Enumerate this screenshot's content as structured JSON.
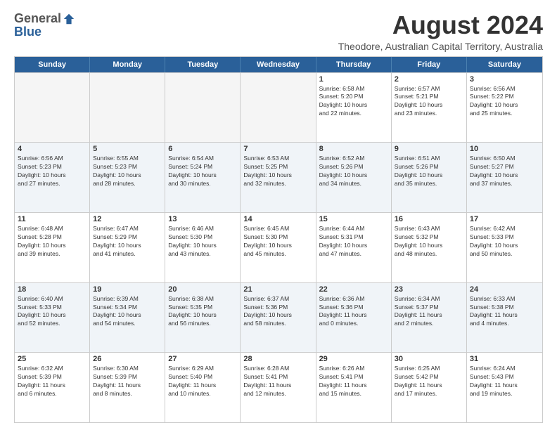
{
  "logo": {
    "general": "General",
    "blue": "Blue"
  },
  "header": {
    "month": "August 2024",
    "location": "Theodore, Australian Capital Territory, Australia"
  },
  "weekdays": [
    "Sunday",
    "Monday",
    "Tuesday",
    "Wednesday",
    "Thursday",
    "Friday",
    "Saturday"
  ],
  "rows": [
    [
      {
        "day": "",
        "text": "",
        "empty": true
      },
      {
        "day": "",
        "text": "",
        "empty": true
      },
      {
        "day": "",
        "text": "",
        "empty": true
      },
      {
        "day": "",
        "text": "",
        "empty": true
      },
      {
        "day": "1",
        "text": "Sunrise: 6:58 AM\nSunset: 5:20 PM\nDaylight: 10 hours\nand 22 minutes."
      },
      {
        "day": "2",
        "text": "Sunrise: 6:57 AM\nSunset: 5:21 PM\nDaylight: 10 hours\nand 23 minutes."
      },
      {
        "day": "3",
        "text": "Sunrise: 6:56 AM\nSunset: 5:22 PM\nDaylight: 10 hours\nand 25 minutes."
      }
    ],
    [
      {
        "day": "4",
        "text": "Sunrise: 6:56 AM\nSunset: 5:23 PM\nDaylight: 10 hours\nand 27 minutes."
      },
      {
        "day": "5",
        "text": "Sunrise: 6:55 AM\nSunset: 5:23 PM\nDaylight: 10 hours\nand 28 minutes."
      },
      {
        "day": "6",
        "text": "Sunrise: 6:54 AM\nSunset: 5:24 PM\nDaylight: 10 hours\nand 30 minutes."
      },
      {
        "day": "7",
        "text": "Sunrise: 6:53 AM\nSunset: 5:25 PM\nDaylight: 10 hours\nand 32 minutes."
      },
      {
        "day": "8",
        "text": "Sunrise: 6:52 AM\nSunset: 5:26 PM\nDaylight: 10 hours\nand 34 minutes."
      },
      {
        "day": "9",
        "text": "Sunrise: 6:51 AM\nSunset: 5:26 PM\nDaylight: 10 hours\nand 35 minutes."
      },
      {
        "day": "10",
        "text": "Sunrise: 6:50 AM\nSunset: 5:27 PM\nDaylight: 10 hours\nand 37 minutes."
      }
    ],
    [
      {
        "day": "11",
        "text": "Sunrise: 6:48 AM\nSunset: 5:28 PM\nDaylight: 10 hours\nand 39 minutes."
      },
      {
        "day": "12",
        "text": "Sunrise: 6:47 AM\nSunset: 5:29 PM\nDaylight: 10 hours\nand 41 minutes."
      },
      {
        "day": "13",
        "text": "Sunrise: 6:46 AM\nSunset: 5:30 PM\nDaylight: 10 hours\nand 43 minutes."
      },
      {
        "day": "14",
        "text": "Sunrise: 6:45 AM\nSunset: 5:30 PM\nDaylight: 10 hours\nand 45 minutes."
      },
      {
        "day": "15",
        "text": "Sunrise: 6:44 AM\nSunset: 5:31 PM\nDaylight: 10 hours\nand 47 minutes."
      },
      {
        "day": "16",
        "text": "Sunrise: 6:43 AM\nSunset: 5:32 PM\nDaylight: 10 hours\nand 48 minutes."
      },
      {
        "day": "17",
        "text": "Sunrise: 6:42 AM\nSunset: 5:33 PM\nDaylight: 10 hours\nand 50 minutes."
      }
    ],
    [
      {
        "day": "18",
        "text": "Sunrise: 6:40 AM\nSunset: 5:33 PM\nDaylight: 10 hours\nand 52 minutes."
      },
      {
        "day": "19",
        "text": "Sunrise: 6:39 AM\nSunset: 5:34 PM\nDaylight: 10 hours\nand 54 minutes."
      },
      {
        "day": "20",
        "text": "Sunrise: 6:38 AM\nSunset: 5:35 PM\nDaylight: 10 hours\nand 56 minutes."
      },
      {
        "day": "21",
        "text": "Sunrise: 6:37 AM\nSunset: 5:36 PM\nDaylight: 10 hours\nand 58 minutes."
      },
      {
        "day": "22",
        "text": "Sunrise: 6:36 AM\nSunset: 5:36 PM\nDaylight: 11 hours\nand 0 minutes."
      },
      {
        "day": "23",
        "text": "Sunrise: 6:34 AM\nSunset: 5:37 PM\nDaylight: 11 hours\nand 2 minutes."
      },
      {
        "day": "24",
        "text": "Sunrise: 6:33 AM\nSunset: 5:38 PM\nDaylight: 11 hours\nand 4 minutes."
      }
    ],
    [
      {
        "day": "25",
        "text": "Sunrise: 6:32 AM\nSunset: 5:39 PM\nDaylight: 11 hours\nand 6 minutes."
      },
      {
        "day": "26",
        "text": "Sunrise: 6:30 AM\nSunset: 5:39 PM\nDaylight: 11 hours\nand 8 minutes."
      },
      {
        "day": "27",
        "text": "Sunrise: 6:29 AM\nSunset: 5:40 PM\nDaylight: 11 hours\nand 10 minutes."
      },
      {
        "day": "28",
        "text": "Sunrise: 6:28 AM\nSunset: 5:41 PM\nDaylight: 11 hours\nand 12 minutes."
      },
      {
        "day": "29",
        "text": "Sunrise: 6:26 AM\nSunset: 5:41 PM\nDaylight: 11 hours\nand 15 minutes."
      },
      {
        "day": "30",
        "text": "Sunrise: 6:25 AM\nSunset: 5:42 PM\nDaylight: 11 hours\nand 17 minutes."
      },
      {
        "day": "31",
        "text": "Sunrise: 6:24 AM\nSunset: 5:43 PM\nDaylight: 11 hours\nand 19 minutes."
      }
    ]
  ]
}
